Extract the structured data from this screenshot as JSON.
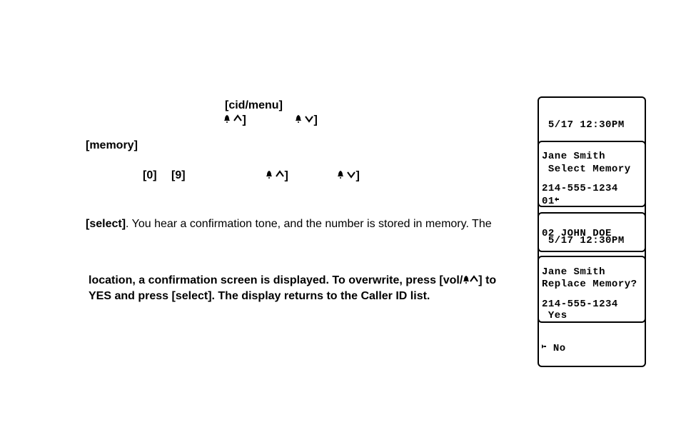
{
  "labels": {
    "cid_menu": "[cid/menu]",
    "bracket_close": "]",
    "memory": "[memory]",
    "key0": "[0]",
    "key9": "[9]"
  },
  "p1": {
    "select_bold": "[select]",
    "after": ". You hear a confirmation tone, and the number is stored in memory. The"
  },
  "p2": {
    "line1a": "location, a confirmation screen is displayed. To overwrite, press [vol/",
    "line1b": "] to",
    "line2a": "YES and press [select]. The display returns to the Caller ID list."
  },
  "lcd1": {
    "l1": " 5/17 12:30PM",
    "l2": "Jane Smith",
    "l3": "214-555-1234"
  },
  "lcd2": {
    "l1": " Select Memory",
    "l2": "01",
    "l3": "02 JOHN DOE"
  },
  "lcd3": {
    "l1": " 5/17 12:30PM",
    "l2": "Jane Smith",
    "l3": "214-555-1234"
  },
  "lcd4": {
    "l1": "Replace Memory?",
    "l2": " Yes",
    "l3": " No"
  }
}
